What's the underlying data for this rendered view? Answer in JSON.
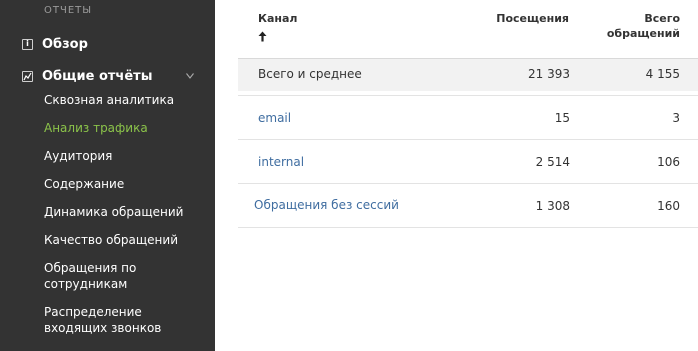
{
  "sidebar": {
    "section_title": "ОТЧЕТЫ",
    "overview_label": "Обзор",
    "general_reports_label": "Общие отчёты",
    "items": [
      {
        "label": "Сквозная аналитика"
      },
      {
        "label": "Анализ трафика",
        "active": true
      },
      {
        "label": "Аудитория"
      },
      {
        "label": "Содержание"
      },
      {
        "label": "Динамика обращений"
      },
      {
        "label": "Качество обращений"
      },
      {
        "label": "Обращения по сотрудникам"
      },
      {
        "label": "Распределение входящих звонков"
      }
    ]
  },
  "table": {
    "columns": [
      "Канал",
      "Посещения",
      "Всего обращений"
    ],
    "total_row": {
      "label": "Всего и среднее",
      "visits": "21 393",
      "requests": "4 155"
    },
    "rows": [
      {
        "channel": "email",
        "visits": "15",
        "requests": "3"
      },
      {
        "channel": "internal",
        "visits": "2 514",
        "requests": "106"
      },
      {
        "channel": "Обращения без сессий",
        "visits": "1 308",
        "requests": "160"
      }
    ]
  },
  "colors": {
    "sidebar_bg": "#333333",
    "active_item": "#8bc34a",
    "link": "#3f6da0"
  }
}
